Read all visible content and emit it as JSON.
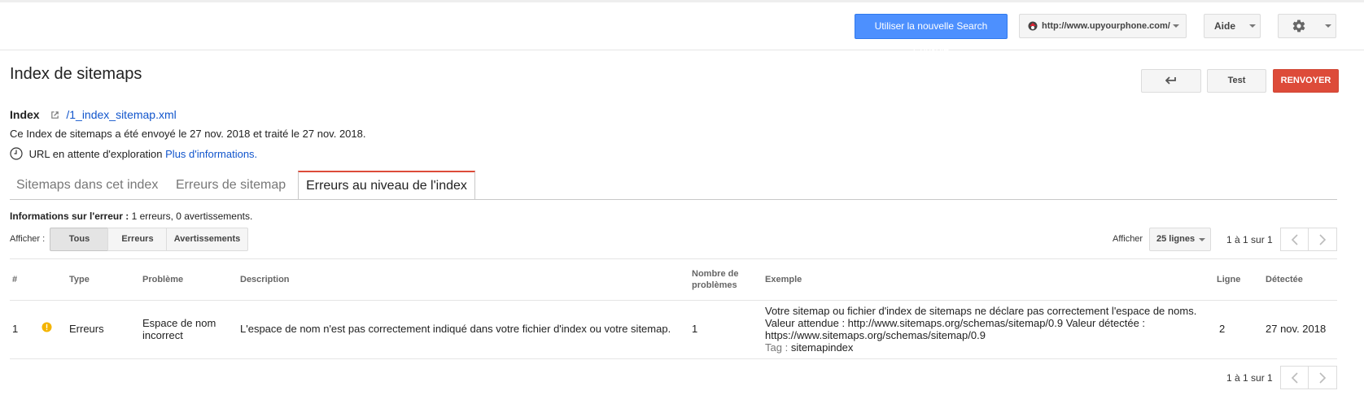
{
  "header": {
    "new_console_label": "Utiliser la nouvelle Search Console",
    "site_url": "http://www.upyourphone.com/",
    "help_label": "Aide"
  },
  "page": {
    "title": "Index de sitemaps",
    "test_label": "Test",
    "resubmit_label": "RENVOYER"
  },
  "index": {
    "label": "Index",
    "link": "/1_index_sitemap.xml",
    "submitted_text": "Ce Index de sitemaps a été envoyé le 27 nov. 2018 et traité le 27 nov. 2018.",
    "pending_text": "URL en attente d'exploration",
    "more_info": "Plus d'informations."
  },
  "tabs": [
    {
      "label": "Sitemaps dans cet index"
    },
    {
      "label": "Erreurs de sitemap"
    },
    {
      "label": "Erreurs au niveau de l'index"
    }
  ],
  "error_info": {
    "label": "Informations sur l'erreur :",
    "value": "1 erreurs, 0 avertissements."
  },
  "filter": {
    "label": "Afficher :",
    "options": [
      "Tous",
      "Erreurs",
      "Avertissements"
    ],
    "selected": "Tous"
  },
  "rows_per_page": {
    "label": "Afficher",
    "value": "25 lignes"
  },
  "pagination": {
    "text": "1 à 1 sur 1"
  },
  "table": {
    "headers": {
      "num": "#",
      "type": "Type",
      "problem": "Problème",
      "description": "Description",
      "count_line1": "Nombre de",
      "count_line2": "problèmes",
      "example": "Exemple",
      "line": "Ligne",
      "detected": "Détectée"
    },
    "rows": [
      {
        "num": "1",
        "type": "Erreurs",
        "problem_line1": "Espace de nom",
        "problem_line2": "incorrect",
        "description": "L'espace de nom n'est pas correctement indiqué dans votre fichier d'index ou votre sitemap.",
        "count": "1",
        "example_line1": "Votre sitemap ou fichier d'index de sitemaps ne déclare pas correctement l'espace de noms.",
        "example_line2": "Valeur attendue : http://www.sitemaps.org/schemas/sitemap/0.9 Valeur détectée :",
        "example_line3": "https://www.sitemaps.org/schemas/sitemap/0.9",
        "tag_label": "Tag :",
        "tag_value": "sitemapindex",
        "line": "2",
        "detected": "27 nov. 2018"
      }
    ]
  },
  "colors": {
    "primary_blue": "#4d90fe",
    "danger_red": "#dd4b39",
    "link_blue": "#1155cc",
    "warning_yellow": "#f4b400"
  },
  "icons": [
    "site-favicon-icon",
    "dropdown-caret-icon",
    "gear-icon",
    "back-arrow-icon",
    "external-link-icon",
    "clock-icon",
    "warning-icon",
    "chevron-left-icon",
    "chevron-right-icon"
  ]
}
